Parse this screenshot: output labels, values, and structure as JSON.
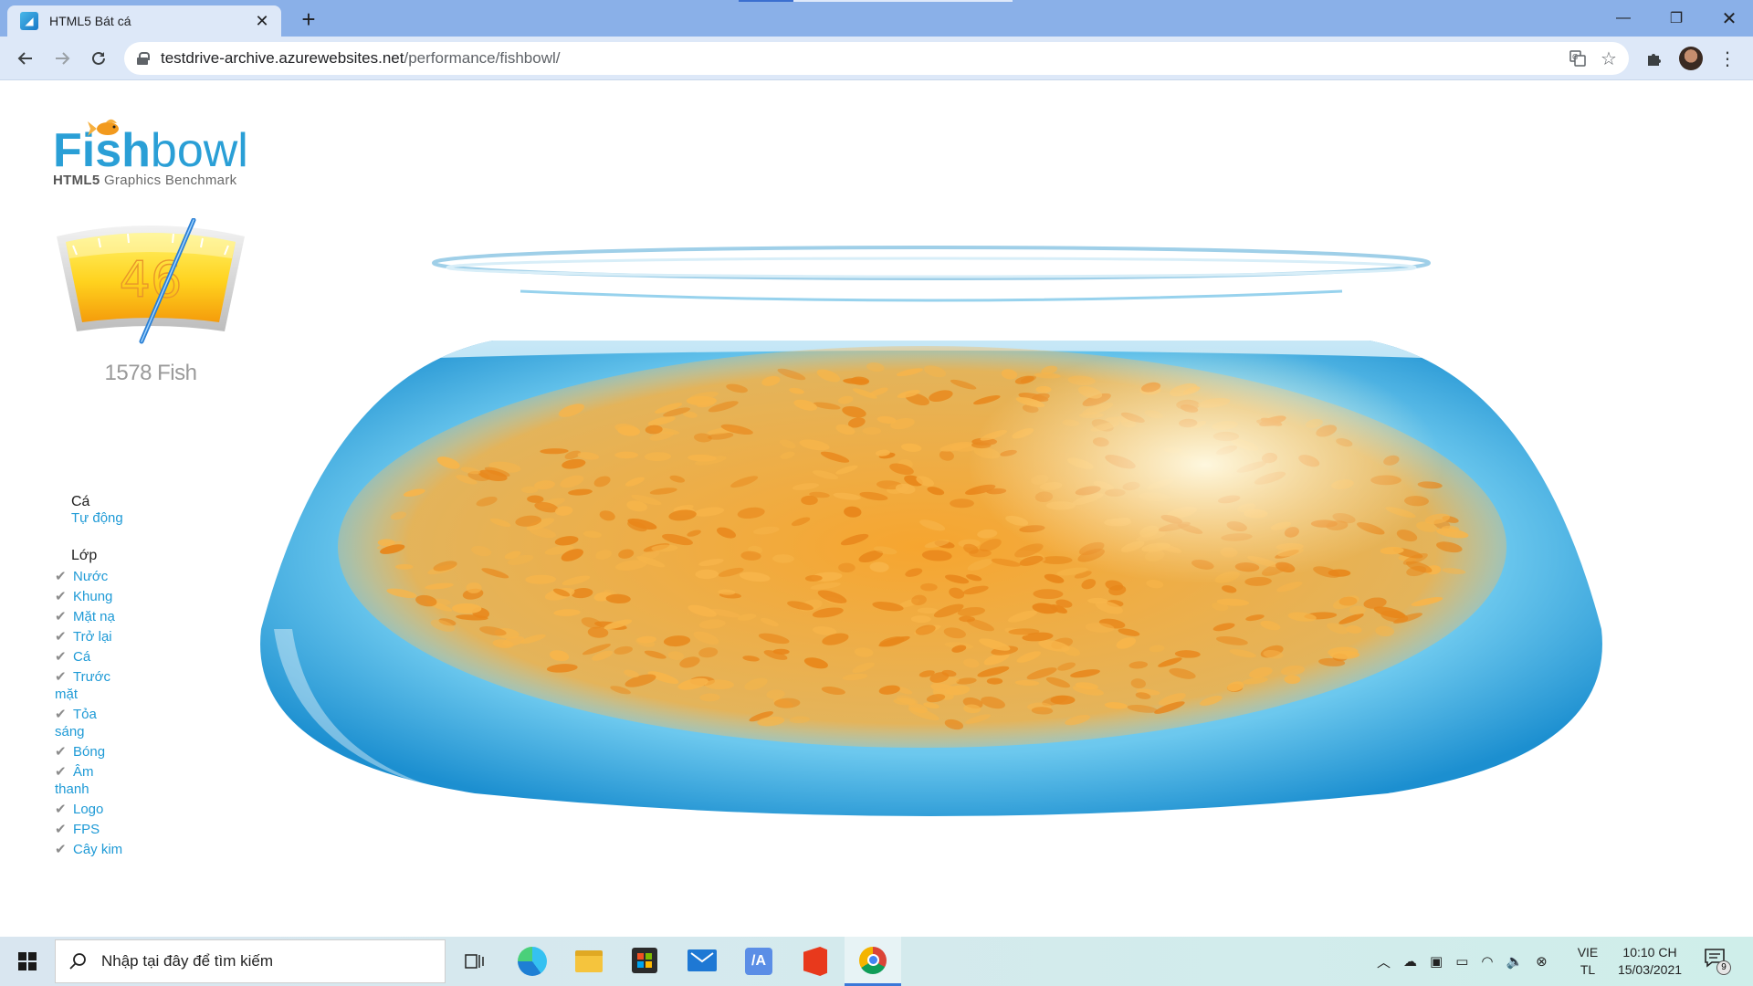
{
  "browser": {
    "tab_title": "HTML5 Bát cá",
    "close_tab": "✕",
    "new_tab": "+",
    "url_domain": "testdrive-archive.azurewebsites.net",
    "url_path": "/performance/fishbowl/",
    "window_controls": {
      "minimize": "—",
      "maximize": "❐",
      "close": "✕"
    }
  },
  "page": {
    "logo": {
      "title_bold": "Fish",
      "title_light": "bowl",
      "subtitle_bold": "HTML5",
      "subtitle_rest": " Graphics Benchmark"
    },
    "gauge": {
      "fps": "46",
      "fps_value": 46
    },
    "fish_count": "1578 Fish",
    "fish_section": {
      "heading": "Cá",
      "mode": "Tự động"
    },
    "layer_section": {
      "heading": "Lớp",
      "items": [
        {
          "line1": "Nước",
          "line2": ""
        },
        {
          "line1": "Khung",
          "line2": ""
        },
        {
          "line1": "Mặt nạ",
          "line2": ""
        },
        {
          "line1": "Trở lại",
          "line2": ""
        },
        {
          "line1": "Cá",
          "line2": ""
        },
        {
          "line1": "Trước",
          "line2": "mặt"
        },
        {
          "line1": "Tỏa",
          "line2": "sáng"
        },
        {
          "line1": "Bóng",
          "line2": ""
        },
        {
          "line1": "Âm",
          "line2": "thanh"
        },
        {
          "line1": "Logo",
          "line2": ""
        },
        {
          "line1": "FPS",
          "line2": ""
        },
        {
          "line1": "Cây kim",
          "line2": ""
        }
      ]
    }
  },
  "taskbar": {
    "search_placeholder": "Nhập tại đây để tìm kiếm",
    "language": "VIE",
    "language_sub": "TL",
    "time": "10:10 CH",
    "date": "15/03/2021",
    "notifications": "9"
  },
  "colors": {
    "accent": "#1e9ad6",
    "tabbar": "#8ab0e8",
    "toolbar": "#dde8f8",
    "taskbar": "#d7eaf0"
  }
}
